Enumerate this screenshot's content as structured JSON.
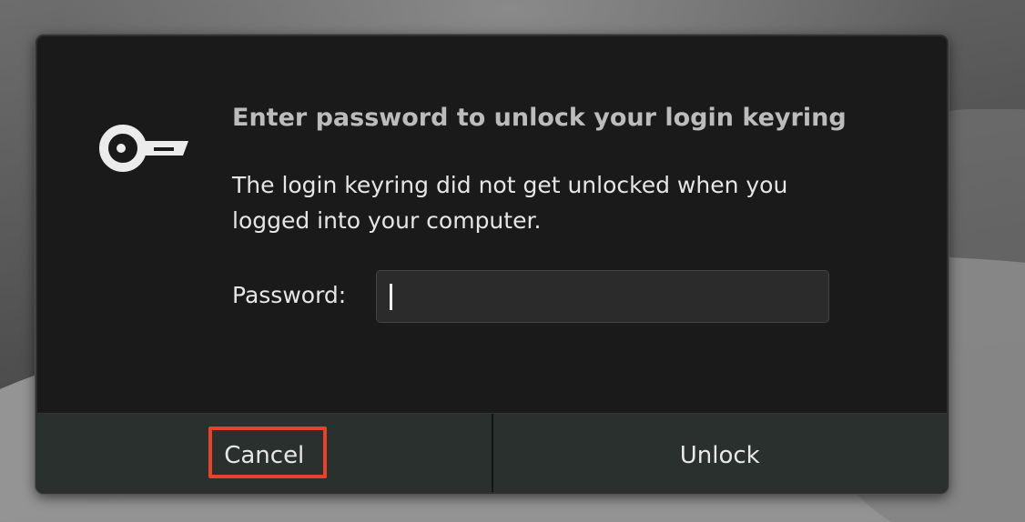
{
  "dialog": {
    "icon": "key-icon",
    "title": "Enter password to unlock your login keyring",
    "message": "The login keyring did not get unlocked when you logged into your computer.",
    "password_label": "Password:",
    "password_value": "",
    "cancel_label": "Cancel",
    "unlock_label": "Unlock"
  },
  "colors": {
    "dialog_background": "#1a1a1a",
    "button_background": "#2a302e",
    "focus_outline": "#e5432b",
    "title_text": "#bcbcbc",
    "body_text": "#e6e6e6"
  }
}
